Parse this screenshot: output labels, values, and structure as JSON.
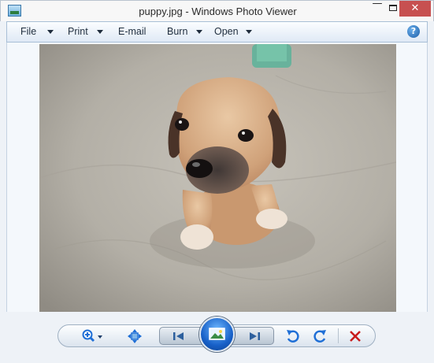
{
  "window": {
    "title": "puppy.jpg - Windows Photo Viewer",
    "minimize_glyph": "—",
    "close_glyph": "✕"
  },
  "menu": {
    "items": [
      {
        "label": "File",
        "has_dropdown": true
      },
      {
        "label": "Print",
        "has_dropdown": true
      },
      {
        "label": "E-mail",
        "has_dropdown": false
      },
      {
        "label": "Burn",
        "has_dropdown": true
      },
      {
        "label": "Open",
        "has_dropdown": true
      }
    ],
    "help_glyph": "?"
  },
  "toolbar": {
    "icons": [
      "zoom-icon",
      "actual-size-icon",
      "previous-icon",
      "slideshow-icon",
      "next-icon",
      "rotate-counterclockwise-icon",
      "rotate-clockwise-icon",
      "delete-icon"
    ],
    "colors": {
      "accent": "#1f6fd6",
      "delete": "#c81c1c"
    }
  }
}
